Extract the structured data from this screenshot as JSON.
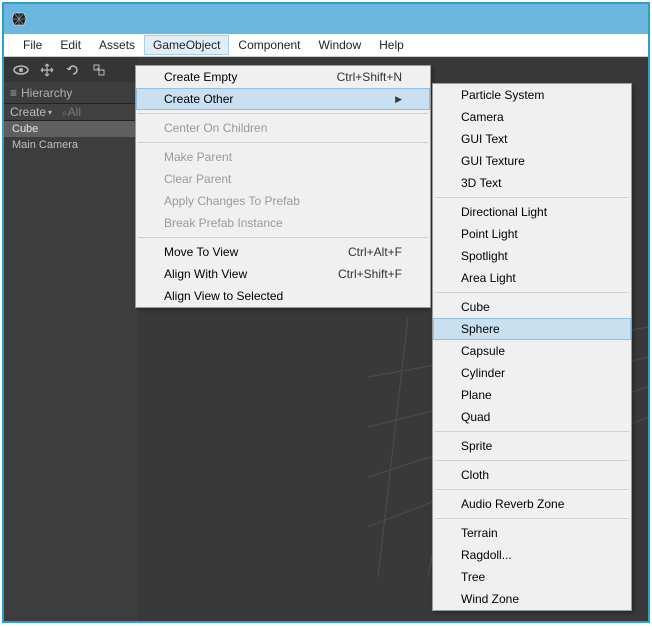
{
  "menubar": {
    "items": [
      {
        "label": "File"
      },
      {
        "label": "Edit"
      },
      {
        "label": "Assets"
      },
      {
        "label": "GameObject"
      },
      {
        "label": "Component"
      },
      {
        "label": "Window"
      },
      {
        "label": "Help"
      }
    ],
    "active_index": 3
  },
  "hierarchy": {
    "tab_label": "Hierarchy",
    "create_label": "Create",
    "search_placeholder": "All",
    "items": [
      {
        "label": "Cube",
        "selected": true
      },
      {
        "label": "Main Camera",
        "selected": false
      }
    ]
  },
  "gameobject_menu": {
    "items": [
      {
        "label": "Create Empty",
        "shortcut": "Ctrl+Shift+N",
        "enabled": true
      },
      {
        "label": "Create Other",
        "submenu": true,
        "enabled": true,
        "highlight": true
      },
      {
        "sep": true
      },
      {
        "label": "Center On Children",
        "enabled": false
      },
      {
        "sep": true
      },
      {
        "label": "Make Parent",
        "enabled": false
      },
      {
        "label": "Clear Parent",
        "enabled": false
      },
      {
        "label": "Apply Changes To Prefab",
        "enabled": false
      },
      {
        "label": "Break Prefab Instance",
        "enabled": false
      },
      {
        "sep": true
      },
      {
        "label": "Move To View",
        "shortcut": "Ctrl+Alt+F",
        "enabled": true
      },
      {
        "label": "Align With View",
        "shortcut": "Ctrl+Shift+F",
        "enabled": true
      },
      {
        "label": "Align View to Selected",
        "enabled": true
      }
    ]
  },
  "create_other_menu": {
    "items": [
      {
        "label": "Particle System"
      },
      {
        "label": "Camera"
      },
      {
        "label": "GUI Text"
      },
      {
        "label": "GUI Texture"
      },
      {
        "label": "3D Text"
      },
      {
        "sep": true
      },
      {
        "label": "Directional Light"
      },
      {
        "label": "Point Light"
      },
      {
        "label": "Spotlight"
      },
      {
        "label": "Area Light"
      },
      {
        "sep": true
      },
      {
        "label": "Cube"
      },
      {
        "label": "Sphere",
        "highlight": true
      },
      {
        "label": "Capsule"
      },
      {
        "label": "Cylinder"
      },
      {
        "label": "Plane"
      },
      {
        "label": "Quad"
      },
      {
        "sep": true
      },
      {
        "label": "Sprite"
      },
      {
        "sep": true
      },
      {
        "label": "Cloth"
      },
      {
        "sep": true
      },
      {
        "label": "Audio Reverb Zone"
      },
      {
        "sep": true
      },
      {
        "label": "Terrain"
      },
      {
        "label": "Ragdoll..."
      },
      {
        "label": "Tree"
      },
      {
        "label": "Wind Zone"
      }
    ]
  }
}
